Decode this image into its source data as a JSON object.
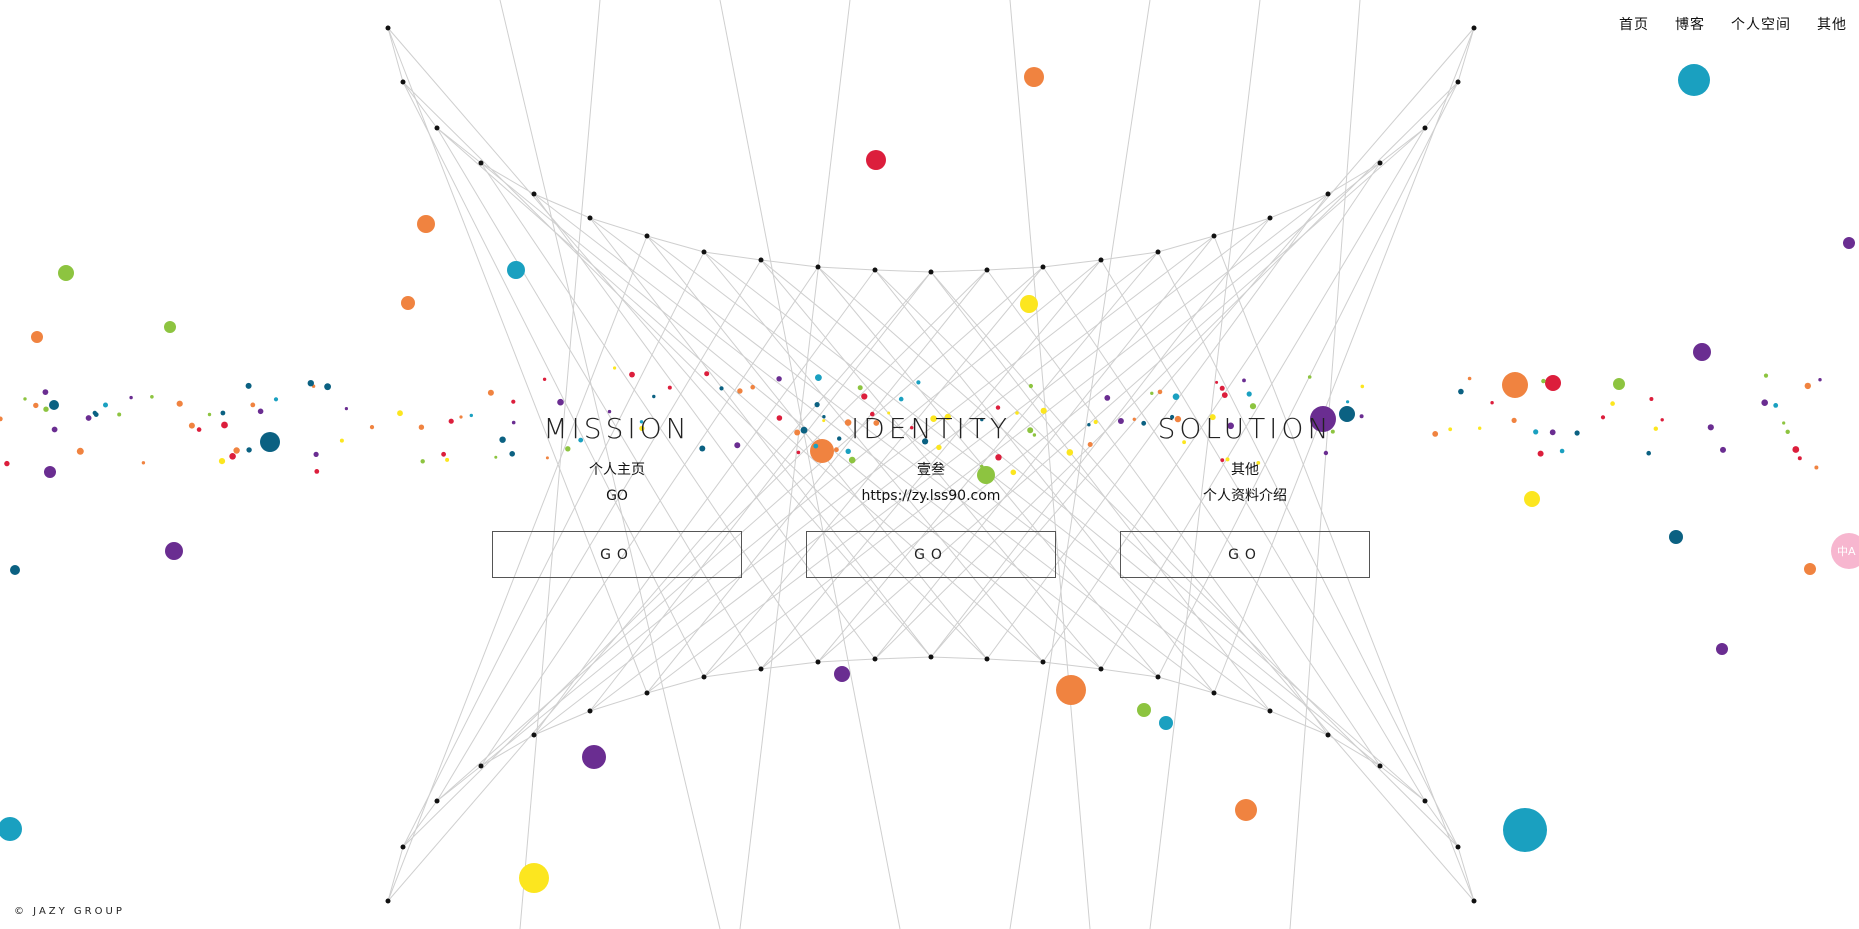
{
  "nav": {
    "items": [
      "首页",
      "博客",
      "个人空间",
      "其他"
    ]
  },
  "panels": [
    {
      "title": "MISSION",
      "line1": "个人主页",
      "line2": "GO",
      "button": "GO"
    },
    {
      "title": "IDENTITY",
      "line1": "壹叁",
      "line2": "https://zy.lss90.com",
      "button": "GO"
    },
    {
      "title": "SOLUTION",
      "line1": "其他",
      "line2": "个人资料介绍",
      "button": "GO"
    }
  ],
  "footer": {
    "text": "© JAZY GROUP"
  },
  "side_tab": {
    "text": "中A"
  },
  "colors": {
    "line": "#cfcfcf",
    "node": "#111111",
    "dots": [
      "#f08340",
      "#dc1e3c",
      "#8dc440",
      "#1aa0c0",
      "#6a2d91",
      "#fce61f",
      "#0b6182"
    ]
  }
}
